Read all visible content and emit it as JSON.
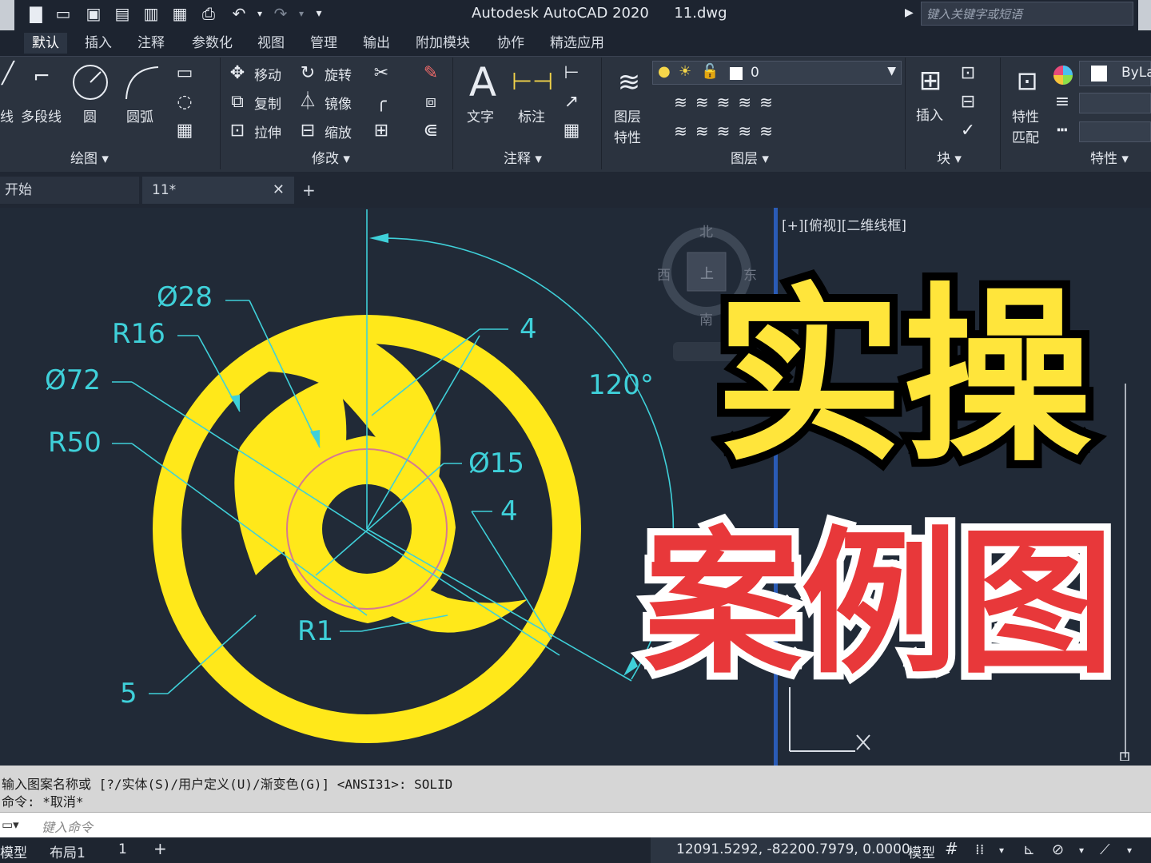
{
  "window": {
    "title": "Autodesk AutoCAD 2020",
    "filename": "11.dwg",
    "search_placeholder": "键入关键字或短语"
  },
  "ribbon_tabs": [
    "默认",
    "插入",
    "注释",
    "参数化",
    "视图",
    "管理",
    "输出",
    "附加模块",
    "协作",
    "精选应用"
  ],
  "ribbon": {
    "draw": {
      "items": [
        "线",
        "多段线",
        "圆",
        "圆弧"
      ],
      "panel": "绘图"
    },
    "modify": {
      "items": [
        "移动",
        "旋转",
        "复制",
        "镜像",
        "拉伸",
        "缩放"
      ],
      "panel": "修改"
    },
    "annotation": {
      "items": [
        "文字",
        "标注"
      ],
      "panel": "注释"
    },
    "layers": {
      "items": [
        "图层",
        "特性"
      ],
      "current_layer": "0",
      "panel": "图层"
    },
    "block": {
      "items": [
        "插入"
      ],
      "panel": "块"
    },
    "properties": {
      "items": [
        "特性",
        "匹配"
      ],
      "bylayer": "ByLa",
      "panel": "特性"
    }
  },
  "doc_tabs": {
    "start": "开始",
    "current": "11*"
  },
  "viewcube": {
    "north": "北",
    "south": "南",
    "east": "东",
    "west": "西",
    "top": "上"
  },
  "viewport_label": "[+][俯视][二维线框]",
  "dimensions": {
    "d28": "Ø28",
    "r16": "R16",
    "d72": "Ø72",
    "r50": "R50",
    "four_top": "4",
    "angle": "120°",
    "d15": "Ø15",
    "four_right": "4",
    "r1": "R1",
    "five": "5"
  },
  "overlay": {
    "line1": "实操",
    "line2": "案例图"
  },
  "colors": {
    "part": "#ffe81a",
    "dimension": "#3fd0d9",
    "overlay_yellow": "#ffe53b",
    "overlay_red": "#e8383a",
    "viewport_border": "#2a5bb6"
  },
  "command": {
    "history_line1": "输入图案名称或 [?/实体(S)/用户定义(U)/渐变色(G)] <ANSI31>: SOLID",
    "history_line2": "命令: *取消*",
    "input_placeholder": "键入命令"
  },
  "status": {
    "model_tab": "模型",
    "layout1": "布局1",
    "layout_num": "1",
    "coordinates": "12091.5292, -82200.7979, 0.0000",
    "model_button": "模型"
  }
}
